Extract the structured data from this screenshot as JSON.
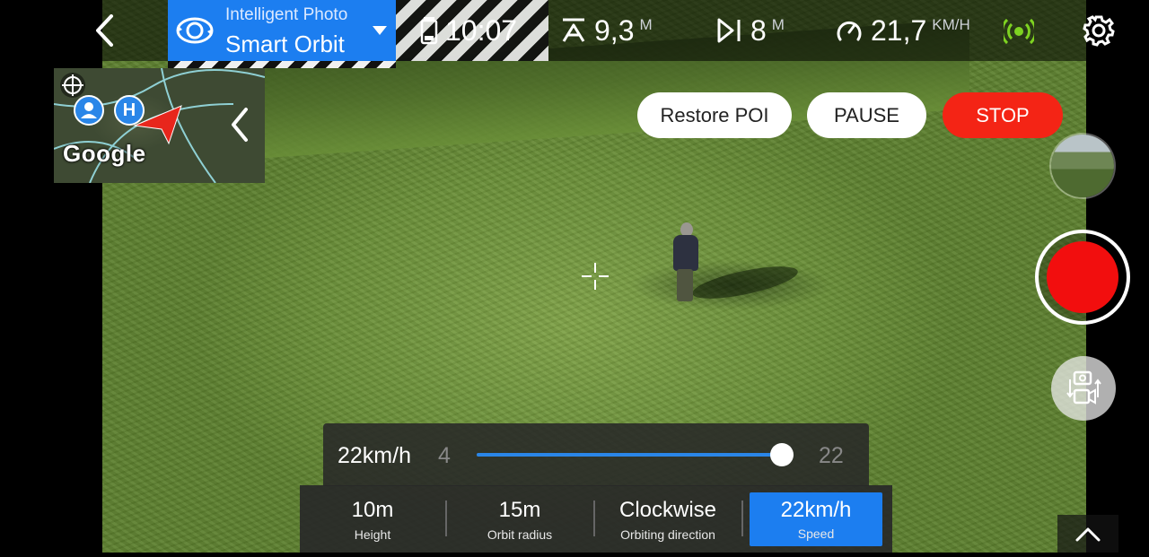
{
  "header": {
    "mode_subtitle": "Intelligent Photo",
    "mode_title": "Smart Orbit",
    "time": "10:07",
    "altitude_value": "9,3",
    "altitude_unit": "M",
    "distance_value": "8",
    "distance_unit": "M",
    "speed_value": "21,7",
    "speed_unit": "KM/H"
  },
  "minimap": {
    "provider_label": "Google",
    "home_marker": "H"
  },
  "actions": {
    "restore_poi": "Restore POI",
    "pause": "PAUSE",
    "stop": "STOP"
  },
  "speed_slider": {
    "current_label": "22km/h",
    "min_label": "4",
    "max_label": "22",
    "min": 4,
    "max": 22,
    "value": 22
  },
  "params": [
    {
      "value": "10m",
      "label": "Height"
    },
    {
      "value": "15m",
      "label": "Orbit radius"
    },
    {
      "value": "Clockwise",
      "label": "Orbiting direction"
    },
    {
      "value": "22km/h",
      "label": "Speed",
      "active": true
    }
  ],
  "icons": {
    "back": "chevron-left-icon",
    "mode": "orbit-icon",
    "mode_dropdown": "caret-down-icon",
    "battery": "battery-icon",
    "altitude": "altitude-icon",
    "distance": "distance-icon",
    "speed": "speedometer-icon",
    "signal": "signal-icon",
    "settings": "gear-icon",
    "map_target": "crosshair-target-icon",
    "map_user": "user-pin-icon",
    "map_aircraft": "aircraft-arrow-icon",
    "map_collapse": "chevron-left-icon",
    "switch_camera": "switch-photo-video-icon",
    "expand": "chevron-up-icon"
  },
  "colors": {
    "accent": "#1c7ef0",
    "stop": "#f42415",
    "record": "#f20e0e",
    "signal": "#7ed321"
  }
}
